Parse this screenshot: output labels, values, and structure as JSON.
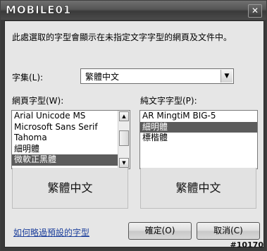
{
  "window": {
    "title_logo": "MOBILE01",
    "close_glyph": "✕"
  },
  "description": "此處選取的字型會顯示在未指定文字字型的網頁及文件中。",
  "charset": {
    "label": "字集(L):",
    "value": "繁體中文"
  },
  "web_font": {
    "label": "網頁字型(W):",
    "items": [
      "Arial Unicode MS",
      "Microsoft Sans Serif",
      "Tahoma",
      "細明體",
      "微軟正黑體"
    ],
    "selected_index": 4,
    "preview": "繁體中文"
  },
  "plain_font": {
    "label": "純文字字型(P):",
    "items": [
      "AR MingtiM BIG-5",
      "細明體",
      "標楷體"
    ],
    "selected_index": 1,
    "preview": "繁體中文"
  },
  "help_link": "如何略過預設的字型",
  "buttons": {
    "ok": "確定(O)",
    "cancel": "取消(C)"
  },
  "watermark": "#10170"
}
